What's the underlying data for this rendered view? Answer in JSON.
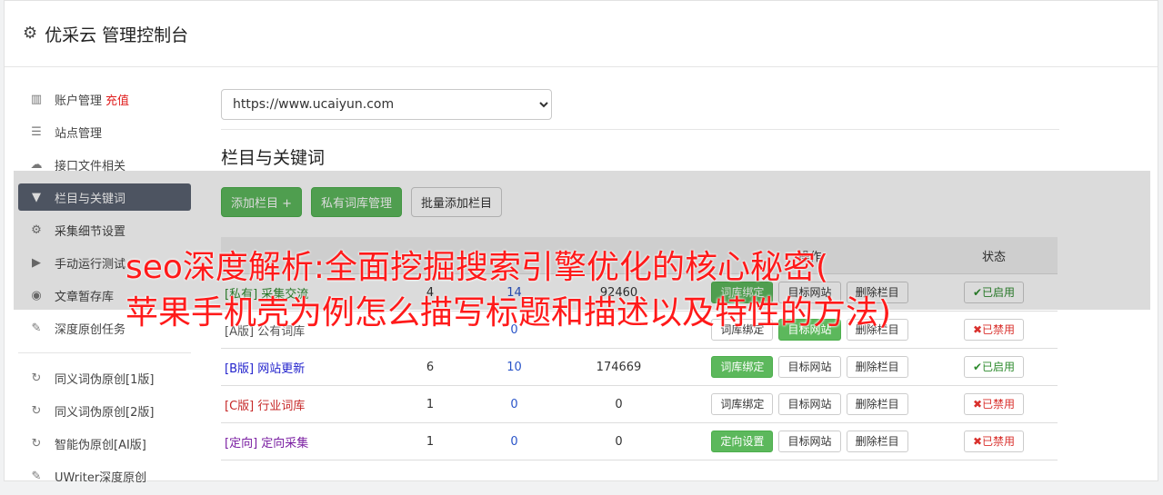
{
  "header": {
    "title": "优采云 管理控制台"
  },
  "sidebar": {
    "items": [
      {
        "label": "账户管理",
        "extra": "充值",
        "icon": "bar-chart-icon"
      },
      {
        "label": "站点管理",
        "icon": "server-icon"
      },
      {
        "label": "接口文件相关",
        "icon": "cloud-upload-icon"
      },
      {
        "label": "栏目与关键词",
        "icon": "filter-icon",
        "active": true
      },
      {
        "label": "采集细节设置",
        "icon": "cogs-icon"
      },
      {
        "label": "手动运行测试",
        "icon": "play-circle-icon"
      },
      {
        "label": "文章暂存库",
        "icon": "database-icon"
      },
      {
        "label": "深度原创任务",
        "icon": "edit-icon"
      }
    ],
    "items2": [
      {
        "label": "同义词伪原创[1版]",
        "icon": "refresh-icon"
      },
      {
        "label": "同义词伪原创[2版]",
        "icon": "refresh-icon"
      },
      {
        "label": "智能伪原创[AI版]",
        "icon": "refresh-icon"
      },
      {
        "label": "UWriter深度原创",
        "icon": "edit-icon"
      }
    ]
  },
  "main": {
    "site_select": "https://www.ucaiyun.com",
    "section_title": "栏目与关键词",
    "buttons": {
      "add": "添加栏目 +",
      "private_lib": "私有词库管理",
      "batch_add": "批量添加栏目"
    },
    "table": {
      "headers": [
        "",
        "",
        "",
        "",
        "操作",
        "状态"
      ],
      "rows": [
        {
          "prefix": "[私有]",
          "name": "采集交流",
          "c1": "4",
          "c2": "14",
          "c3": "92460",
          "bind": "词库绑定",
          "target": "目标网站",
          "del": "删除栏目",
          "status": "已启用",
          "on": true
        },
        {
          "prefix": "[A版]",
          "name": "公有词库",
          "c1": "",
          "c2": "0",
          "c3": "",
          "bind": "词库绑定",
          "target": "目标网站",
          "del": "删除栏目",
          "status": "已禁用",
          "on": false
        },
        {
          "prefix": "[B版]",
          "name": "网站更新",
          "c1": "6",
          "c2": "10",
          "c3": "174669",
          "bind": "词库绑定",
          "target": "目标网站",
          "del": "删除栏目",
          "status": "已启用",
          "on": true
        },
        {
          "prefix": "[C版]",
          "name": "行业词库",
          "c1": "1",
          "c2": "0",
          "c3": "0",
          "bind": "词库绑定",
          "target": "目标网站",
          "del": "删除栏目",
          "status": "已禁用",
          "on": false
        },
        {
          "prefix": "[定向]",
          "name": "定向采集",
          "c1": "1",
          "c2": "0",
          "c3": "0",
          "bind": "定向设置",
          "target": "目标网站",
          "del": "删除栏目",
          "status": "已禁用",
          "on": false
        }
      ]
    }
  },
  "overlay": {
    "line1": "seo深度解析:全面挖掘搜索引擎优化的核心秘密(",
    "line2": "苹果手机壳为例怎么描写标题和描述以及特性的方法)"
  }
}
